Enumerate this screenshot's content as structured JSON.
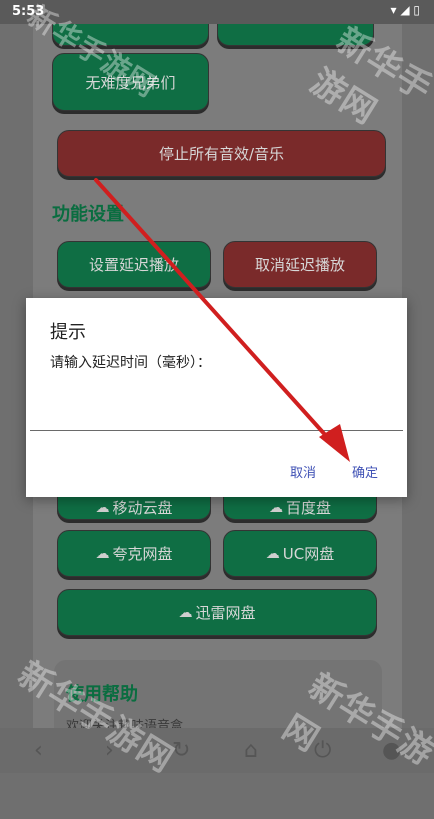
{
  "status": {
    "time": "5:53",
    "icons": "▾ ◢ ▯"
  },
  "buttons": {
    "top_left": "",
    "top_right": "",
    "brothers": "无难度兄弟们",
    "stop_audio": "停止所有音效/音乐",
    "set_delay": "设置延迟播放",
    "cancel_delay": "取消延迟播放",
    "mobile_cloud": "移动云盘",
    "baidu": "百度盘",
    "quark": "夸克网盘",
    "uc": "UC网盘",
    "xunlei": "迅雷网盘"
  },
  "section": {
    "settings_title": "功能设置"
  },
  "help": {
    "title": "使用帮助",
    "text": "欢迎关注趣味语音盒"
  },
  "dialog": {
    "title": "提示",
    "message": "请输入延迟时间（毫秒）：",
    "input_value": "",
    "cancel": "取消",
    "confirm": "确定"
  },
  "watermark": "新华手游网",
  "colors": {
    "green": "#0f6e44",
    "red": "#7a2a2a",
    "arrow": "#d01f1f",
    "dialog_button": "#3f51b5"
  },
  "icons": {
    "cloud": "cloud-icon",
    "back": "back-icon",
    "refresh": "refresh-icon",
    "home": "home-icon",
    "power": "power-icon"
  }
}
